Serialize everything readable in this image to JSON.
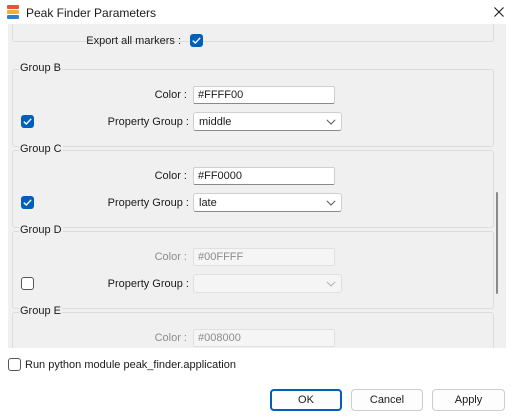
{
  "window": {
    "title": "Peak Finder Parameters"
  },
  "top_partial": {
    "export_label": "Export all markers :",
    "export_checked": true
  },
  "groups": [
    {
      "title": "Group B",
      "color_label": "Color :",
      "color_value": "#FFFF00",
      "property_group_label": "Property Group :",
      "property_group_value": "middle",
      "enabled": true
    },
    {
      "title": "Group C",
      "color_label": "Color :",
      "color_value": "#FF0000",
      "property_group_label": "Property Group :",
      "property_group_value": "late",
      "enabled": true
    },
    {
      "title": "Group D",
      "color_label": "Color :",
      "color_value": "#00FFFF",
      "property_group_label": "Property Group :",
      "property_group_value": "",
      "enabled": false
    },
    {
      "title": "Group E",
      "color_label": "Color :",
      "color_value": "#008000",
      "enabled": false
    }
  ],
  "run_module": {
    "label": "Run python module peak_finder.application",
    "checked": false
  },
  "buttons": {
    "ok": "OK",
    "cancel": "Cancel",
    "apply": "Apply"
  },
  "colors": {
    "accent": "#005fb8",
    "panel_bg": "#f0f0f0",
    "window_bg": "#ffffff"
  }
}
